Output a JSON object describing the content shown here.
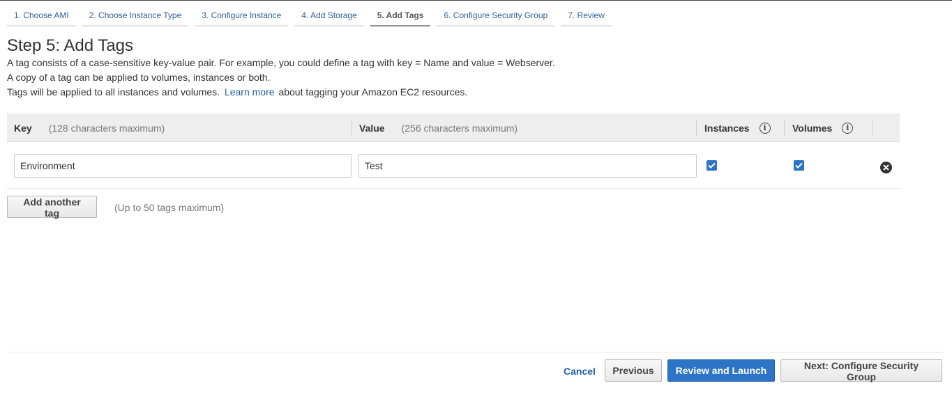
{
  "wizard": {
    "steps": [
      {
        "label": "1. Choose AMI"
      },
      {
        "label": "2. Choose Instance Type"
      },
      {
        "label": "3. Configure Instance"
      },
      {
        "label": "4. Add Storage"
      },
      {
        "label": "5. Add Tags"
      },
      {
        "label": "6. Configure Security Group"
      },
      {
        "label": "7. Review"
      }
    ],
    "active_step": "5. Add Tags"
  },
  "page": {
    "title": "Step 5: Add Tags",
    "desc_line1": "A tag consists of a case-sensitive key-value pair. For example, you could define a tag with key = Name and value = Webserver.",
    "desc_line2": "A copy of a tag can be applied to volumes, instances or both.",
    "desc_line3_pre": "Tags will be applied to all instances and volumes.",
    "learn_more": "Learn more",
    "desc_line3_post": "about tagging your Amazon EC2 resources."
  },
  "table": {
    "key_header": "Key",
    "key_hint": "(128 characters maximum)",
    "value_header": "Value",
    "value_hint": "(256 characters maximum)",
    "instances_header": "Instances",
    "volumes_header": "Volumes",
    "info_glyph": "i",
    "rows": [
      {
        "key": "Environment",
        "value": "Test",
        "instances": true,
        "volumes": true
      }
    ]
  },
  "add_tag": {
    "button_label": "Add another tag",
    "hint": "(Up to 50 tags maximum)"
  },
  "footer": {
    "cancel": "Cancel",
    "previous": "Previous",
    "review_launch": "Review and Launch",
    "next": "Next: Configure Security Group"
  },
  "colors": {
    "link": "#1f5fa6",
    "primary": "#2d74c7"
  }
}
